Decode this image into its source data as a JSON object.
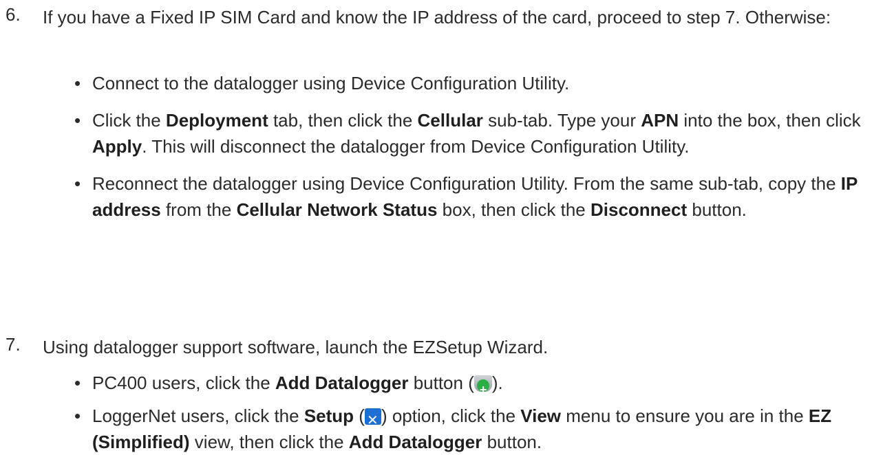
{
  "steps": [
    {
      "number": "6.",
      "intro": "If you have a Fixed IP SIM Card and know the IP address of the card, proceed to step 7. Otherwise:",
      "bullets": [
        {
          "parts": [
            {
              "t": "Connect to the datalogger using Device Configuration Utility.",
              "b": false
            }
          ]
        },
        {
          "parts": [
            {
              "t": "Click the ",
              "b": false
            },
            {
              "t": "Deployment",
              "b": true
            },
            {
              "t": " tab, then click the ",
              "b": false
            },
            {
              "t": "Cellular",
              "b": true
            },
            {
              "t": " sub-tab. Type your ",
              "b": false
            },
            {
              "t": "APN",
              "b": true
            },
            {
              "t": " into the box, then click ",
              "b": false
            },
            {
              "t": "Apply",
              "b": true
            },
            {
              "t": ". This will disconnect the datalogger from Device Configuration Utility.",
              "b": false
            }
          ]
        },
        {
          "parts": [
            {
              "t": "Reconnect the datalogger using Device Configuration Utility. From the same sub-tab, copy the ",
              "b": false
            },
            {
              "t": "IP address",
              "b": true
            },
            {
              "t": " from the ",
              "b": false
            },
            {
              "t": "Cellular Network Status",
              "b": true
            },
            {
              "t": " box, then click the ",
              "b": false
            },
            {
              "t": "Disconnect",
              "b": true
            },
            {
              "t": " button.",
              "b": false
            }
          ]
        }
      ]
    },
    {
      "number": "7.",
      "intro": "Using datalogger support software, launch the EZSetup Wizard.",
      "bullets": [
        {
          "parts": [
            {
              "t": "PC400 users, click the ",
              "b": false
            },
            {
              "t": "Add Datalogger",
              "b": true
            },
            {
              "t": " button (",
              "b": false
            },
            {
              "icon": "add-datalogger-icon"
            },
            {
              "t": ").",
              "b": false
            }
          ]
        },
        {
          "parts": [
            {
              "t": "LoggerNet users, click the ",
              "b": false
            },
            {
              "t": "Setup",
              "b": true
            },
            {
              "t": " (",
              "b": false
            },
            {
              "icon": "setup-icon"
            },
            {
              "t": ") option, click the ",
              "b": false
            },
            {
              "t": "View",
              "b": true
            },
            {
              "t": " menu to ensure you are in the ",
              "b": false
            },
            {
              "t": "EZ (Simplified)",
              "b": true
            },
            {
              "t": " view, then click the ",
              "b": false
            },
            {
              "t": "Add Datalogger",
              "b": true
            },
            {
              "t": " button.",
              "b": false
            }
          ]
        }
      ]
    }
  ]
}
